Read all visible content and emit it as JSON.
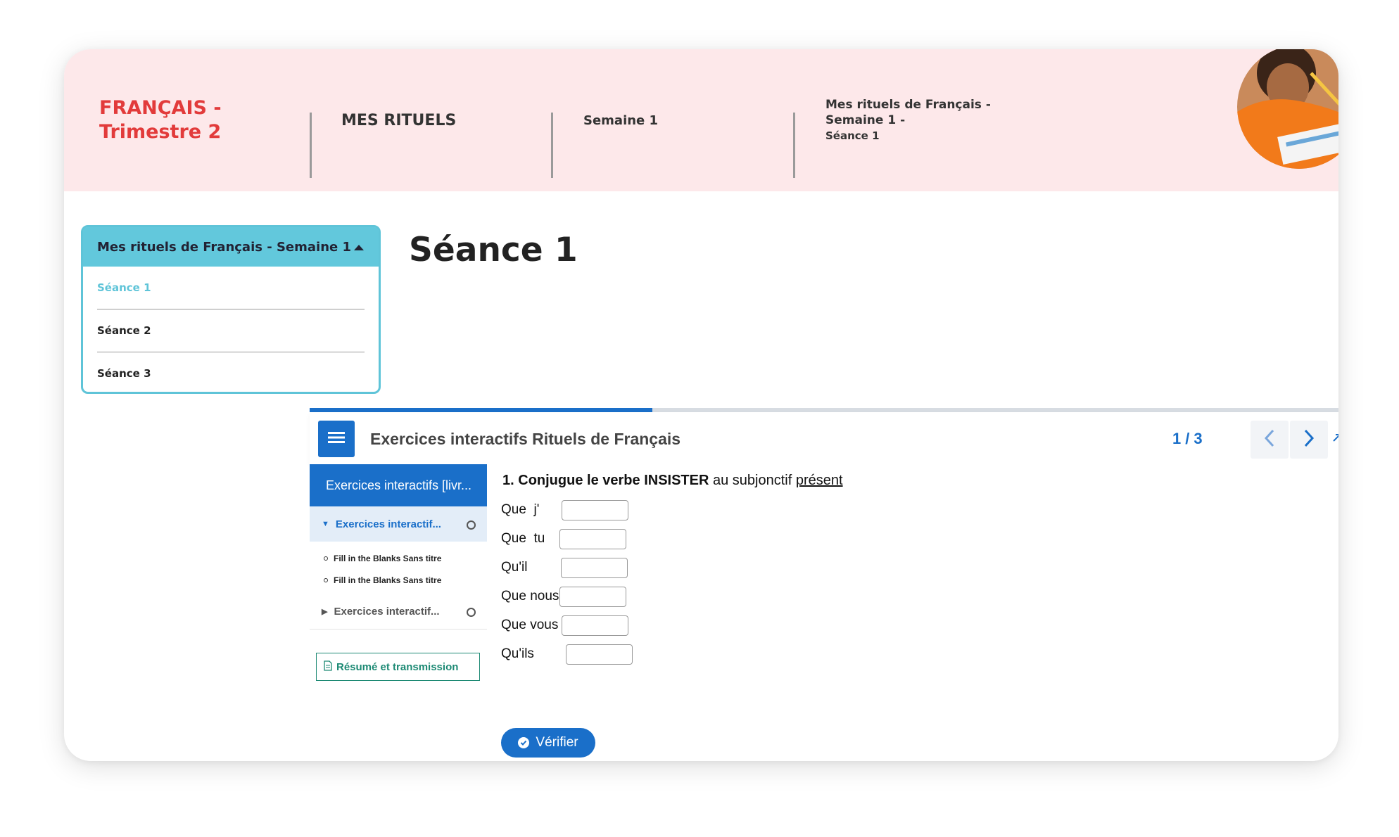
{
  "breadcrumb": {
    "subject_line1": "FRANÇAIS -",
    "subject_line2": "Trimestre 2",
    "section": "MES RITUELS",
    "week": "Semaine 1",
    "lesson_line1": "Mes rituels de Français -",
    "lesson_line2": "Semaine 1 -",
    "lesson_line3": "Séance 1"
  },
  "accordion": {
    "title": "Mes rituels de Français - Semaine 1",
    "items": [
      "Séance 1",
      "Séance 2",
      "Séance 3"
    ],
    "active_index": 0
  },
  "page": {
    "title": "Séance 1"
  },
  "widget": {
    "title": "Exercices interactifs Rituels de Français",
    "page_current": "1",
    "page_total": "3",
    "page_separator": "/",
    "progress": 0.333
  },
  "sidebar": {
    "header": "Exercices interactifs [livr...",
    "group1_label": "Exercices interactif...",
    "subitems": [
      "Fill in the Blanks Sans titre",
      "Fill in the Blanks Sans titre"
    ],
    "group2_label": "Exercices interactif...",
    "resume_button": "Résumé et transmission"
  },
  "exercise": {
    "number": "1.",
    "prefix": "Conjugue le verbe",
    "verb": "INSISTER",
    "middle": "au subjonctif",
    "tense": "présent",
    "pronouns": [
      "Que  j'",
      "Que  tu",
      "Qu'il",
      "Que nous",
      "Que vous",
      "Qu'ils"
    ],
    "answers": [
      "",
      "",
      "",
      "",
      "",
      ""
    ],
    "verify_button": "Vérifier"
  },
  "colors": {
    "header_bg": "#fde8ea",
    "subject_red": "#e23b3b",
    "accordion_teal": "#5fc4d8",
    "primary_blue": "#1a6fc9",
    "resume_green": "#1d8a74"
  }
}
